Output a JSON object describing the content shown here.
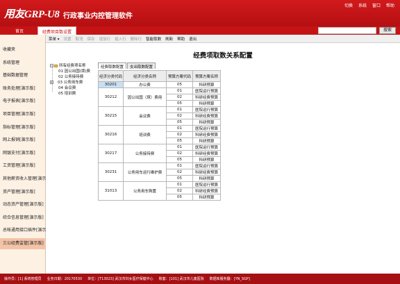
{
  "app": {
    "logo_text": "用友GRP-U8",
    "subtitle": "行政事业内控管理软件",
    "top_menu": [
      "切换",
      "系统",
      "窗口",
      "帮助"
    ]
  },
  "tabs": {
    "home": "首页",
    "active": "经费项目数设置"
  },
  "search": {
    "placeholder": "",
    "button": "搜索"
  },
  "sidebar": {
    "items": [
      "收藏夹",
      "系统管理",
      "基础数据管理",
      "账务处理[演示版]",
      "电子报表[演示版]",
      "项目管理[演示版]",
      "指标管理[演示版]",
      "网上报销[演示版]",
      "网银支付[演示版]",
      "工资管理[演示版]",
      "其他薪资收入管理[演示",
      "资产管理[演示版]",
      "动态资产管理[演示版]",
      "综合信息管理[演示版]",
      "总帐通用接口插件[演示",
      "三公经费监管[演示版]"
    ],
    "active_index": 15
  },
  "toolbar": {
    "items": [
      {
        "label": "菜单 ▾",
        "enabled": true
      },
      {
        "label": "设置",
        "enabled": false
      },
      {
        "label": "取消",
        "enabled": false
      },
      {
        "label": "保存",
        "enabled": false
      },
      {
        "label": "增加行",
        "enabled": false
      },
      {
        "label": "插入行",
        "enabled": false
      },
      {
        "label": "删除行",
        "enabled": false
      },
      {
        "label": "智能取数",
        "enabled": true
      },
      {
        "label": "刷新",
        "enabled": true
      },
      {
        "label": "帮助",
        "enabled": true
      },
      {
        "label": "退出",
        "enabled": true
      }
    ]
  },
  "main": {
    "title": "经费项取数关系配置",
    "tree": {
      "root": "所有经费项名称",
      "children": [
        {
          "label": "01 因公出国(境)费",
          "expandable": false
        },
        {
          "label": "02 公务接待费",
          "expandable": false
        },
        {
          "label": "03 公务用车费",
          "expandable": true
        },
        {
          "label": "04 会议费",
          "expandable": false
        },
        {
          "label": "05 培训费",
          "expandable": false
        }
      ]
    },
    "subtabs": [
      "经费取数配置",
      "支出取数配置"
    ],
    "table": {
      "headers": [
        "经济分类代码",
        "经济分类名称",
        "预算方案代码",
        "预算方案名称"
      ],
      "groups": [
        {
          "code": "30201",
          "name": "办公费",
          "rows": [
            [
              "05",
              "科研预算"
            ]
          ]
        },
        {
          "code": "30212",
          "name": "因公出国（境）费用",
          "rows": [
            [
              "01",
              "医院运行预算"
            ],
            [
              "02",
              "科研经费预算"
            ],
            [
              "05",
              "科研预算"
            ]
          ]
        },
        {
          "code": "30215",
          "name": "会议费",
          "rows": [
            [
              "01",
              "医院运行预算"
            ],
            [
              "02",
              "科研经费预算"
            ],
            [
              "05",
              "科研预算"
            ]
          ]
        },
        {
          "code": "30216",
          "name": "培训费",
          "rows": [
            [
              "01",
              "医院运行预算"
            ],
            [
              "02",
              "科研经费预算"
            ],
            [
              "05",
              "科研预算"
            ]
          ]
        },
        {
          "code": "30217",
          "name": "公务接待费",
          "rows": [
            [
              "01",
              "医院运行预算"
            ],
            [
              "02",
              "科研经费预算"
            ],
            [
              "05",
              "科研预算"
            ]
          ]
        },
        {
          "code": "30231",
          "name": "公务用车运行维护费",
          "rows": [
            [
              "01",
              "医院运行预算"
            ],
            [
              "02",
              "科研经费预算"
            ],
            [
              "05",
              "科研预算"
            ]
          ]
        },
        {
          "code": "31013",
          "name": "公务用车购置",
          "rows": [
            [
              "01",
              "医院运行预算"
            ],
            [
              "02",
              "科研经费预算"
            ],
            [
              "05",
              "科研预算"
            ]
          ]
        }
      ]
    }
  },
  "status": {
    "items": [
      "操作员：[1] 系统管理员",
      "业务日期：20170530",
      "单位：[T13023] 武汉市妇女医疗保健中心",
      "账套：[101] 武汉市儿童医院",
      "数据库服务器：[YN_SGP]"
    ]
  },
  "colors": {
    "brand_red": "#c51416",
    "sidebar_bg": "#fdf1e4",
    "sidebar_active": "#f3c3a7",
    "selected_cell": "#c8e0f4"
  }
}
